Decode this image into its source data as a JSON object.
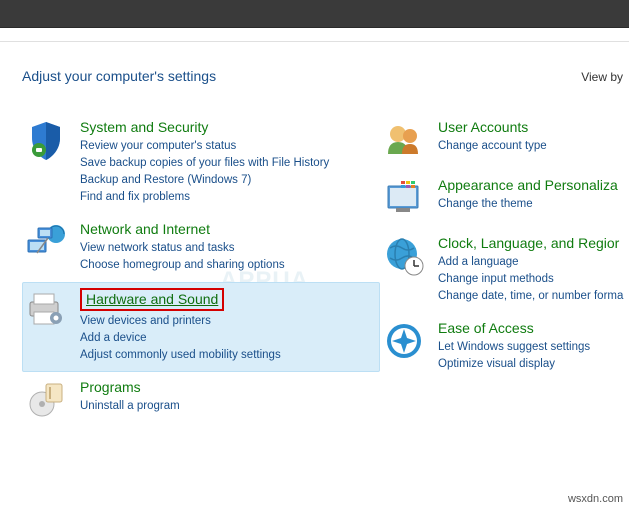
{
  "header": {
    "title": "Adjust your computer's settings",
    "view_by": "View by"
  },
  "left": [
    {
      "key": "system-security",
      "title": "System and Security",
      "links": [
        "Review your computer's status",
        "Save backup copies of your files with File History",
        "Backup and Restore (Windows 7)",
        "Find and fix problems"
      ]
    },
    {
      "key": "network-internet",
      "title": "Network and Internet",
      "links": [
        "View network status and tasks",
        "Choose homegroup and sharing options"
      ]
    },
    {
      "key": "hardware-sound",
      "title": "Hardware and Sound",
      "highlighted": true,
      "boxed": true,
      "links": [
        "View devices and printers",
        "Add a device",
        "Adjust commonly used mobility settings"
      ]
    },
    {
      "key": "programs",
      "title": "Programs",
      "links": [
        "Uninstall a program"
      ]
    }
  ],
  "right": [
    {
      "key": "user-accounts",
      "title": "User Accounts",
      "links": [
        "Change account type"
      ]
    },
    {
      "key": "appearance-personalization",
      "title": "Appearance and Personaliza",
      "links": [
        "Change the theme"
      ]
    },
    {
      "key": "clock-language-region",
      "title": "Clock, Language, and Regior",
      "links": [
        "Add a language",
        "Change input methods",
        "Change date, time, or number forma"
      ]
    },
    {
      "key": "ease-of-access",
      "title": "Ease of Access",
      "links": [
        "Let Windows suggest settings",
        "Optimize visual display"
      ]
    }
  ],
  "watermark": "wsxdn.com",
  "bg_watermark": "APPUA"
}
